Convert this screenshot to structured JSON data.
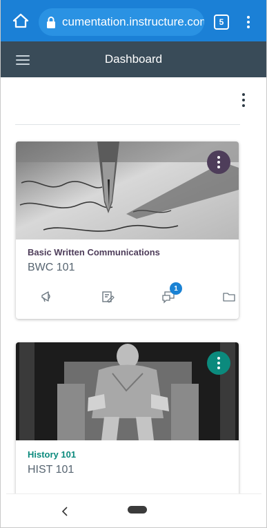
{
  "browser": {
    "url": "cumentation.instructure.com",
    "tab_count": "5",
    "icons": {
      "home": "home-icon",
      "lock": "lock-icon",
      "menu": "more-vert-icon"
    }
  },
  "app_header": {
    "title": "Dashboard",
    "menu_icon": "hamburger-icon"
  },
  "dashboard": {
    "options_icon": "more-vert-icon",
    "courses": [
      {
        "title": "Basic Written Communications",
        "code": "BWC 101",
        "color": "#4e3d5a",
        "image": "fountain-pen-writing",
        "actions": [
          {
            "icon": "announcements-icon",
            "badge": ""
          },
          {
            "icon": "assignments-icon",
            "badge": ""
          },
          {
            "icon": "discussions-icon",
            "badge": "1"
          },
          {
            "icon": "files-icon",
            "badge": ""
          }
        ]
      },
      {
        "title": "History 101",
        "code": "HIST 101",
        "color": "#0b8a7d",
        "image": "lincoln-memorial-statue"
      }
    ]
  },
  "system_nav": {
    "back_icon": "chevron-left-icon",
    "home_icon": "home-pill-icon"
  }
}
